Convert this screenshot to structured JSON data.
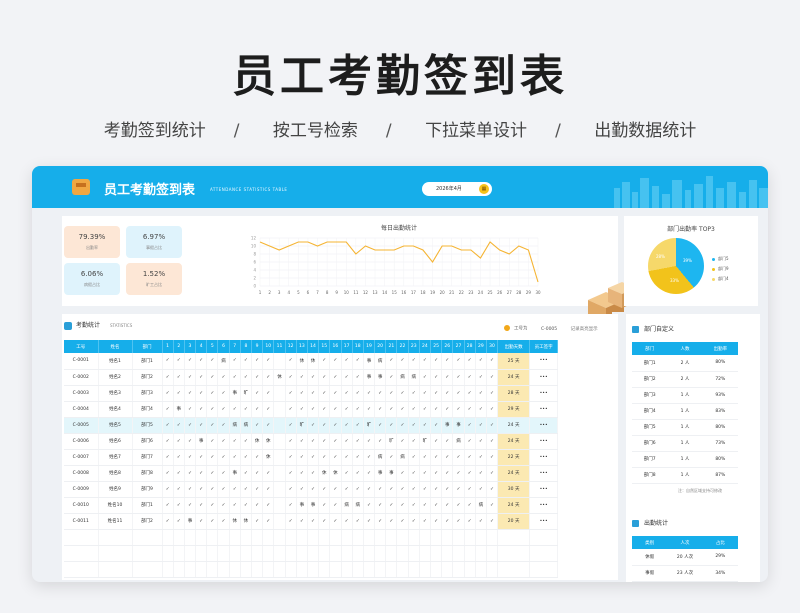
{
  "hero": {
    "title": "员工考勤签到表",
    "features": [
      "考勤签到统计",
      "按工号检索",
      "下拉菜单设计",
      "出勤数据统计"
    ],
    "separator": "/"
  },
  "banner": {
    "title": "员工考勤签到表",
    "subtitle_en": "ATTENDANCE STATISTICS TABLE",
    "date": "2026年4月",
    "calendar_icon": "calendar-icon"
  },
  "kpis": [
    {
      "value": "79.39%",
      "label": "出勤率"
    },
    {
      "value": "6.97%",
      "label": "事假占比"
    },
    {
      "value": "6.06%",
      "label": "病假占比"
    },
    {
      "value": "1.52%",
      "label": "旷工占比"
    }
  ],
  "daily_chart_title": "每日出勤统计",
  "chart_data": {
    "type": "line",
    "title": "每日出勤统计",
    "x": [
      1,
      2,
      3,
      4,
      5,
      6,
      7,
      8,
      9,
      10,
      11,
      12,
      13,
      14,
      15,
      16,
      17,
      18,
      19,
      20,
      21,
      22,
      23,
      24,
      25,
      26,
      27,
      28,
      29,
      30
    ],
    "series": [
      {
        "values": [
          11,
          10,
          9,
          10,
          11,
          11,
          10,
          11,
          11,
          11,
          8,
          10,
          9,
          9,
          9,
          10,
          10,
          9,
          6,
          10,
          10,
          9,
          9,
          7,
          11,
          9,
          8,
          10,
          9,
          1
        ]
      }
    ],
    "ylim": [
      0,
      12
    ],
    "yticks": [
      0,
      2,
      4,
      6,
      8,
      10,
      12
    ],
    "color": "#f5b433",
    "grid": true
  },
  "top5": {
    "title": "部门出勤率 TOP3",
    "slices": [
      {
        "label": "部门5",
        "pct": "39%",
        "color": "#1db6f0"
      },
      {
        "label": "部门9",
        "pct": "33%",
        "color": "#f2c31b"
      },
      {
        "label": "部门4",
        "pct": "28%",
        "color": "#f6d86a"
      }
    ]
  },
  "attendance": {
    "section_title": "考勤统计",
    "section_en": "STATISTICS",
    "search_label": "工号为",
    "search_code": "C-0005",
    "search_hint": "记录高亮显示",
    "columns": {
      "id": "工号",
      "name": "姓名",
      "dept": "部门",
      "total": "出勤天数",
      "sign": "员工签字"
    },
    "days": [
      1,
      2,
      3,
      4,
      5,
      6,
      7,
      8,
      9,
      10,
      11,
      12,
      13,
      14,
      15,
      16,
      17,
      18,
      19,
      20,
      21,
      22,
      23,
      24,
      25,
      26,
      27,
      28,
      29,
      30
    ],
    "highlight_index": 4,
    "rows": [
      {
        "id": "C-0001",
        "name": "姓名1",
        "dept": "部门1",
        "marks": [
          "✓",
          "✓",
          "✓",
          "✓",
          "✓",
          "病",
          "✓",
          "✓",
          "✓",
          "✓",
          "",
          "✓",
          "休",
          "休",
          "✓",
          "✓",
          "✓",
          "✓",
          "事",
          "病",
          "✓",
          "✓",
          "✓",
          "✓",
          "✓",
          "✓",
          "✓",
          "✓",
          "✓",
          "✓"
        ],
        "total": "25 天",
        "sign": "•••"
      },
      {
        "id": "C-0002",
        "name": "姓名2",
        "dept": "部门2",
        "marks": [
          "✓",
          "✓",
          "✓",
          "✓",
          "✓",
          "✓",
          "✓",
          "✓",
          "✓",
          "✓",
          "休",
          "✓",
          "✓",
          "✓",
          "✓",
          "✓",
          "✓",
          "✓",
          "事",
          "事",
          "✓",
          "病",
          "病",
          "✓",
          "✓",
          "✓",
          "✓",
          "✓",
          "✓",
          "✓"
        ],
        "total": "24 天",
        "sign": "•••"
      },
      {
        "id": "C-0003",
        "name": "姓名3",
        "dept": "部门3",
        "marks": [
          "✓",
          "✓",
          "✓",
          "✓",
          "✓",
          "✓",
          "事",
          "旷",
          "✓",
          "✓",
          "",
          "✓",
          "✓",
          "✓",
          "✓",
          "✓",
          "✓",
          "✓",
          "✓",
          "✓",
          "✓",
          "✓",
          "✓",
          "✓",
          "✓",
          "✓",
          "✓",
          "✓",
          "✓",
          "✓"
        ],
        "total": "28 天",
        "sign": "•••"
      },
      {
        "id": "C-0004",
        "name": "姓名4",
        "dept": "部门4",
        "marks": [
          "✓",
          "事",
          "✓",
          "✓",
          "✓",
          "✓",
          "✓",
          "✓",
          "✓",
          "✓",
          "",
          "✓",
          "✓",
          "✓",
          "✓",
          "✓",
          "✓",
          "✓",
          "✓",
          "✓",
          "✓",
          "✓",
          "✓",
          "✓",
          "✓",
          "✓",
          "✓",
          "✓",
          "✓",
          "✓"
        ],
        "total": "29 天",
        "sign": "•••"
      },
      {
        "id": "C-0005",
        "name": "姓名5",
        "dept": "部门5",
        "marks": [
          "✓",
          "✓",
          "✓",
          "✓",
          "✓",
          "✓",
          "病",
          "病",
          "✓",
          "✓",
          "",
          "✓",
          "旷",
          "✓",
          "✓",
          "✓",
          "✓",
          "✓",
          "旷",
          "✓",
          "✓",
          "✓",
          "✓",
          "✓",
          "✓",
          "事",
          "事",
          "✓",
          "✓",
          "✓"
        ],
        "total": "24 天",
        "sign": "•••"
      },
      {
        "id": "C-0006",
        "name": "姓名6",
        "dept": "部门6",
        "marks": [
          "✓",
          "✓",
          "✓",
          "事",
          "✓",
          "✓",
          "✓",
          "✓",
          "休",
          "休",
          "",
          "✓",
          "✓",
          "✓",
          "✓",
          "✓",
          "✓",
          "✓",
          "✓",
          "✓",
          "旷",
          "✓",
          "✓",
          "旷",
          "✓",
          "✓",
          "病",
          "✓",
          "✓",
          "✓"
        ],
        "total": "24 天",
        "sign": "•••"
      },
      {
        "id": "C-0007",
        "name": "姓名7",
        "dept": "部门7",
        "marks": [
          "✓",
          "✓",
          "✓",
          "✓",
          "✓",
          "✓",
          "✓",
          "✓",
          "✓",
          "休",
          "",
          "✓",
          "✓",
          "✓",
          "✓",
          "✓",
          "✓",
          "✓",
          "✓",
          "病",
          "✓",
          "病",
          "✓",
          "✓",
          "✓",
          "✓",
          "✓",
          "✓",
          "✓",
          "✓"
        ],
        "total": "22 天",
        "sign": "•••"
      },
      {
        "id": "C-0008",
        "name": "姓名8",
        "dept": "部门8",
        "marks": [
          "✓",
          "✓",
          "✓",
          "✓",
          "✓",
          "✓",
          "事",
          "✓",
          "✓",
          "✓",
          "",
          "✓",
          "✓",
          "✓",
          "休",
          "休",
          "✓",
          "✓",
          "✓",
          "事",
          "事",
          "✓",
          "✓",
          "✓",
          "✓",
          "✓",
          "✓",
          "✓",
          "✓",
          "✓"
        ],
        "total": "24 天",
        "sign": "•••"
      },
      {
        "id": "C-0009",
        "name": "姓名9",
        "dept": "部门9",
        "marks": [
          "✓",
          "✓",
          "✓",
          "✓",
          "✓",
          "✓",
          "✓",
          "✓",
          "✓",
          "✓",
          "",
          "✓",
          "✓",
          "✓",
          "✓",
          "✓",
          "✓",
          "✓",
          "✓",
          "✓",
          "✓",
          "✓",
          "✓",
          "✓",
          "✓",
          "✓",
          "✓",
          "✓",
          "✓",
          "✓"
        ],
        "total": "30 天",
        "sign": "•••"
      },
      {
        "id": "C-0010",
        "name": "姓名10",
        "dept": "部门1",
        "marks": [
          "✓",
          "✓",
          "✓",
          "✓",
          "✓",
          "✓",
          "✓",
          "✓",
          "✓",
          "✓",
          "",
          "✓",
          "事",
          "事",
          "✓",
          "✓",
          "病",
          "病",
          "✓",
          "✓",
          "✓",
          "✓",
          "✓",
          "✓",
          "✓",
          "✓",
          "✓",
          "✓",
          "病",
          "✓"
        ],
        "total": "24 天",
        "sign": "•••"
      },
      {
        "id": "C-0011",
        "name": "姓名11",
        "dept": "部门2",
        "marks": [
          "✓",
          "✓",
          "事",
          "✓",
          "✓",
          "✓",
          "休",
          "休",
          "✓",
          "✓",
          "",
          "✓",
          "✓",
          "✓",
          "✓",
          "✓",
          "✓",
          "✓",
          "✓",
          "✓",
          "✓",
          "✓",
          "✓",
          "✓",
          "✓",
          "✓",
          "✓",
          "✓",
          "✓",
          "✓"
        ],
        "total": "20 天",
        "sign": "•••"
      }
    ]
  },
  "dept_def": {
    "title": "部门自定义",
    "columns": [
      "部门",
      "人数",
      "出勤率"
    ],
    "rows": [
      [
        "部门1",
        "2 人",
        "80%"
      ],
      [
        "部门2",
        "2 人",
        "72%"
      ],
      [
        "部门3",
        "1 人",
        "93%"
      ],
      [
        "部门4",
        "1 人",
        "83%"
      ],
      [
        "部门5",
        "1 人",
        "80%"
      ],
      [
        "部门6",
        "1 人",
        "73%"
      ],
      [
        "部门7",
        "1 人",
        "80%"
      ],
      [
        "部门8",
        "1 人",
        "87%"
      ]
    ],
    "note": "注：自然区域支持可修改"
  },
  "att_stats": {
    "title": "出勤统计",
    "columns": [
      "类别",
      "人次",
      "占比"
    ],
    "rows": [
      [
        "休假",
        "20 人次",
        "29%"
      ],
      [
        "事假",
        "23 人次",
        "34%"
      ]
    ]
  }
}
